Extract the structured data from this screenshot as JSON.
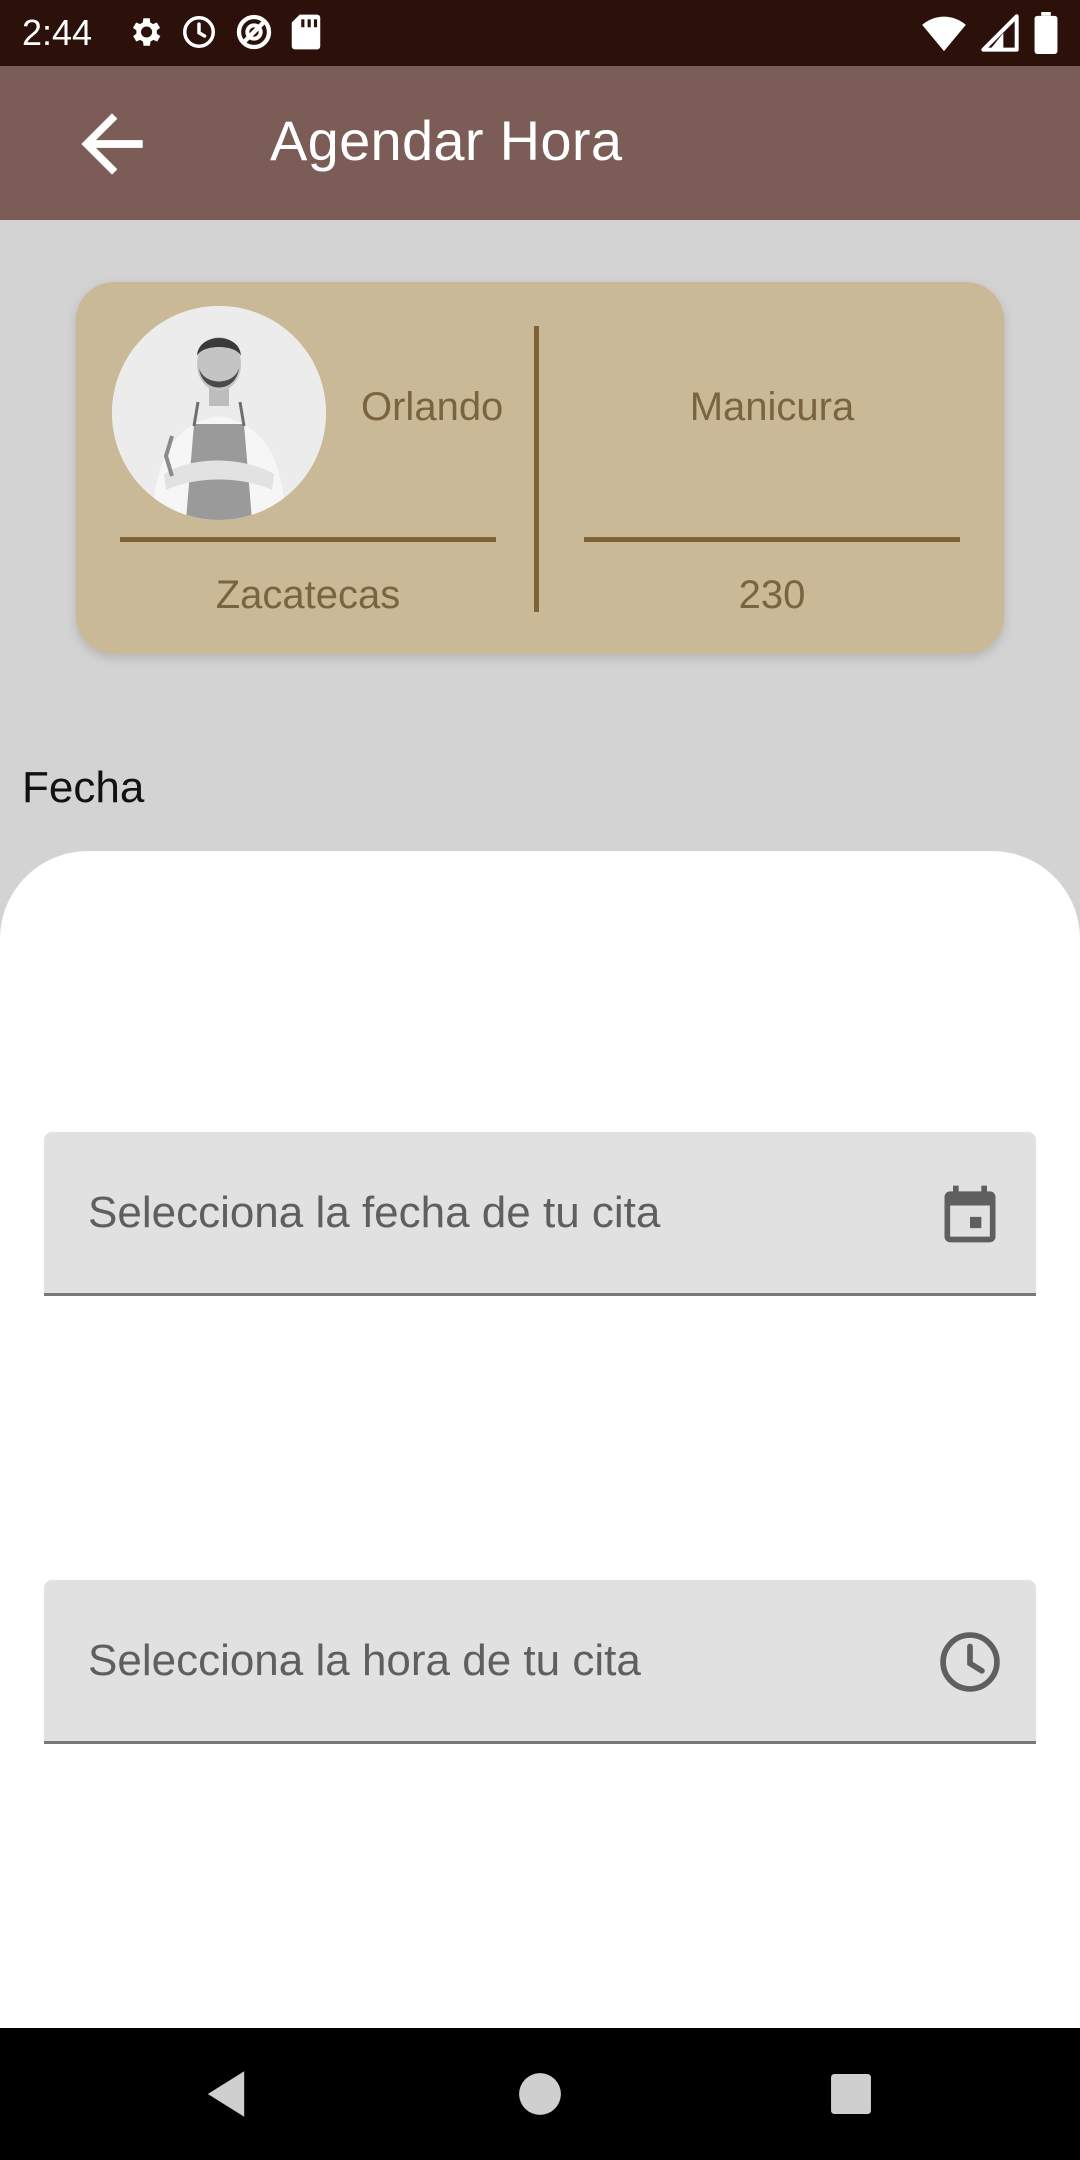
{
  "status_bar": {
    "time": "2:44",
    "left_icons": [
      "settings-icon",
      "alarm-icon",
      "data-saver-icon",
      "sd-card-icon"
    ],
    "right_icons": [
      "wifi-icon",
      "signal-icon",
      "battery-icon"
    ]
  },
  "app_bar": {
    "title": "Agendar Hora",
    "back_icon": "arrow-back-icon"
  },
  "card": {
    "stylist_name": "Orlando",
    "location": "Zacatecas",
    "service": "Manicura",
    "price": "230",
    "colors": {
      "card_bg": "#c9b996",
      "text": "#7a6440",
      "rule": "#7d6337"
    }
  },
  "section_label": "Fecha",
  "date_field": {
    "placeholder": "Selecciona la fecha de tu cita",
    "icon": "calendar-icon"
  },
  "time_field": {
    "placeholder": "Selecciona la hora de tu cita",
    "icon": "clock-icon"
  },
  "nav_bar": {
    "icons": [
      "nav-back-icon",
      "nav-home-icon",
      "nav-recents-icon"
    ]
  },
  "colors": {
    "status_bar": "#2c100a",
    "app_bar": "#7b5c56",
    "background": "#d3d3d4"
  }
}
